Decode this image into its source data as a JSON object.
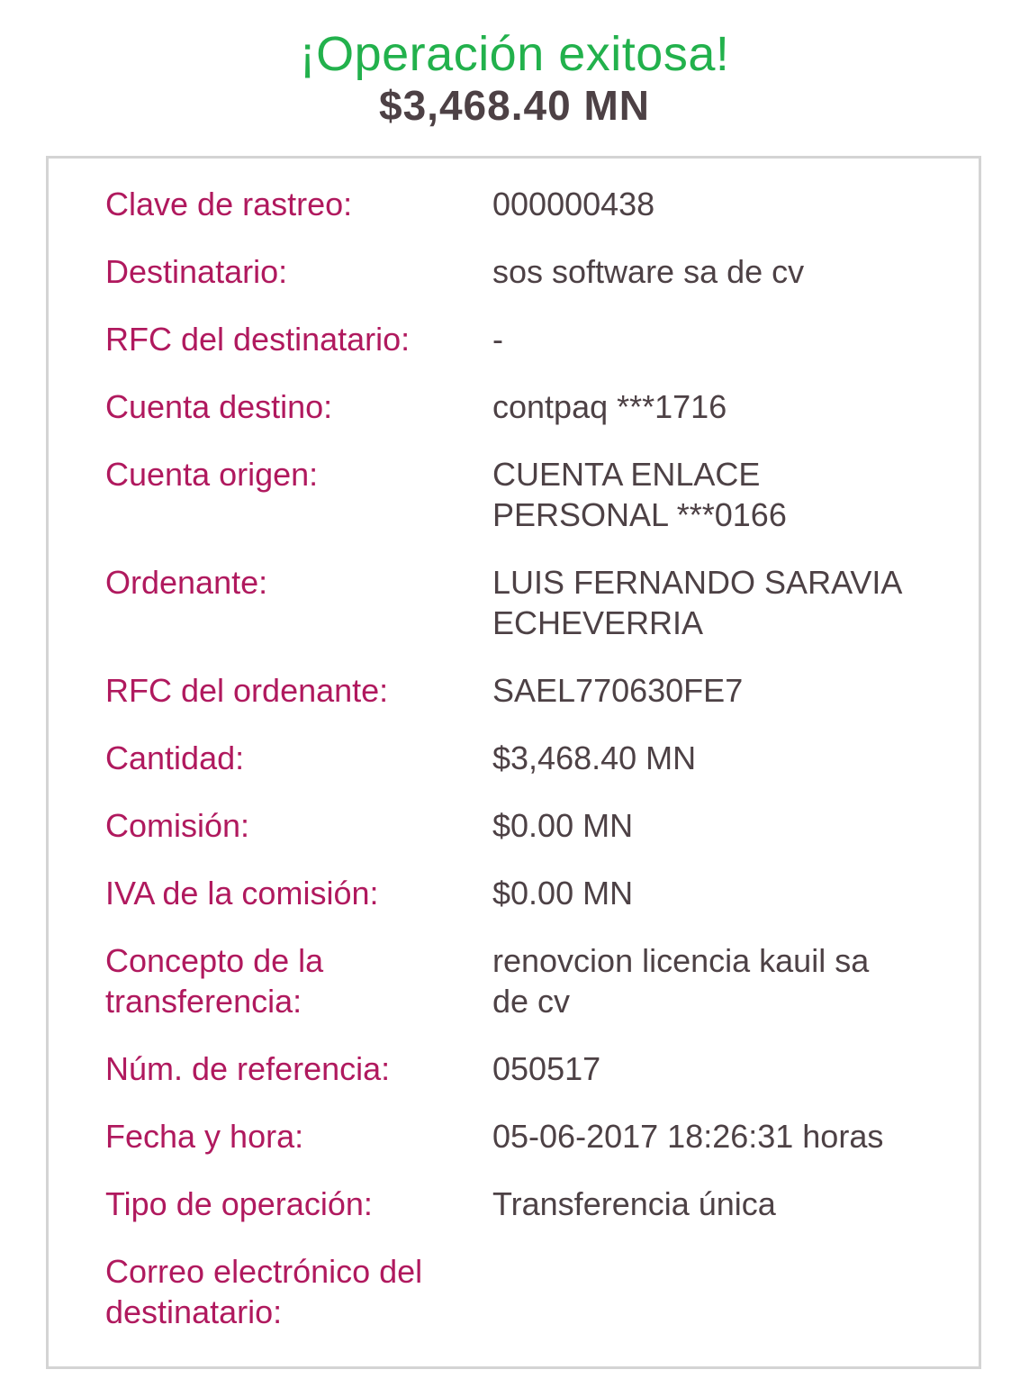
{
  "header": {
    "title": "¡Operación exitosa!",
    "amount": "$3,468.40 MN"
  },
  "colors": {
    "success": "#22b14c",
    "label": "#b0195e",
    "value": "#4d4145",
    "border": "#d4d4d4"
  },
  "details": [
    {
      "label": "Clave de rastreo:",
      "value": "000000438"
    },
    {
      "label": "Destinatario:",
      "value": "sos software sa de cv"
    },
    {
      "label": "RFC del destinatario:",
      "value": "-"
    },
    {
      "label": "Cuenta destino:",
      "value": "contpaq ***1716"
    },
    {
      "label": "Cuenta origen:",
      "value": "CUENTA ENLACE\nPERSONAL ***0166"
    },
    {
      "label": "Ordenante:",
      "value": "LUIS FERNANDO SARAVIA\nECHEVERRIA"
    },
    {
      "label": "RFC del ordenante:",
      "value": "SAEL770630FE7"
    },
    {
      "label": "Cantidad:",
      "value": "$3,468.40 MN"
    },
    {
      "label": "Comisión:",
      "value": "$0.00 MN"
    },
    {
      "label": "IVA de la comisión:",
      "value": "$0.00 MN"
    },
    {
      "label": "Concepto de la\ntransferencia:",
      "value": "renovcion licencia kauil sa\nde cv"
    },
    {
      "label": "Núm. de referencia:",
      "value": "050517"
    },
    {
      "label": "Fecha y hora:",
      "value": "05-06-2017 18:26:31 horas"
    },
    {
      "label": "Tipo de operación:",
      "value": "Transferencia única"
    },
    {
      "label": "Correo electrónico del\ndestinatario:",
      "value": ""
    }
  ]
}
